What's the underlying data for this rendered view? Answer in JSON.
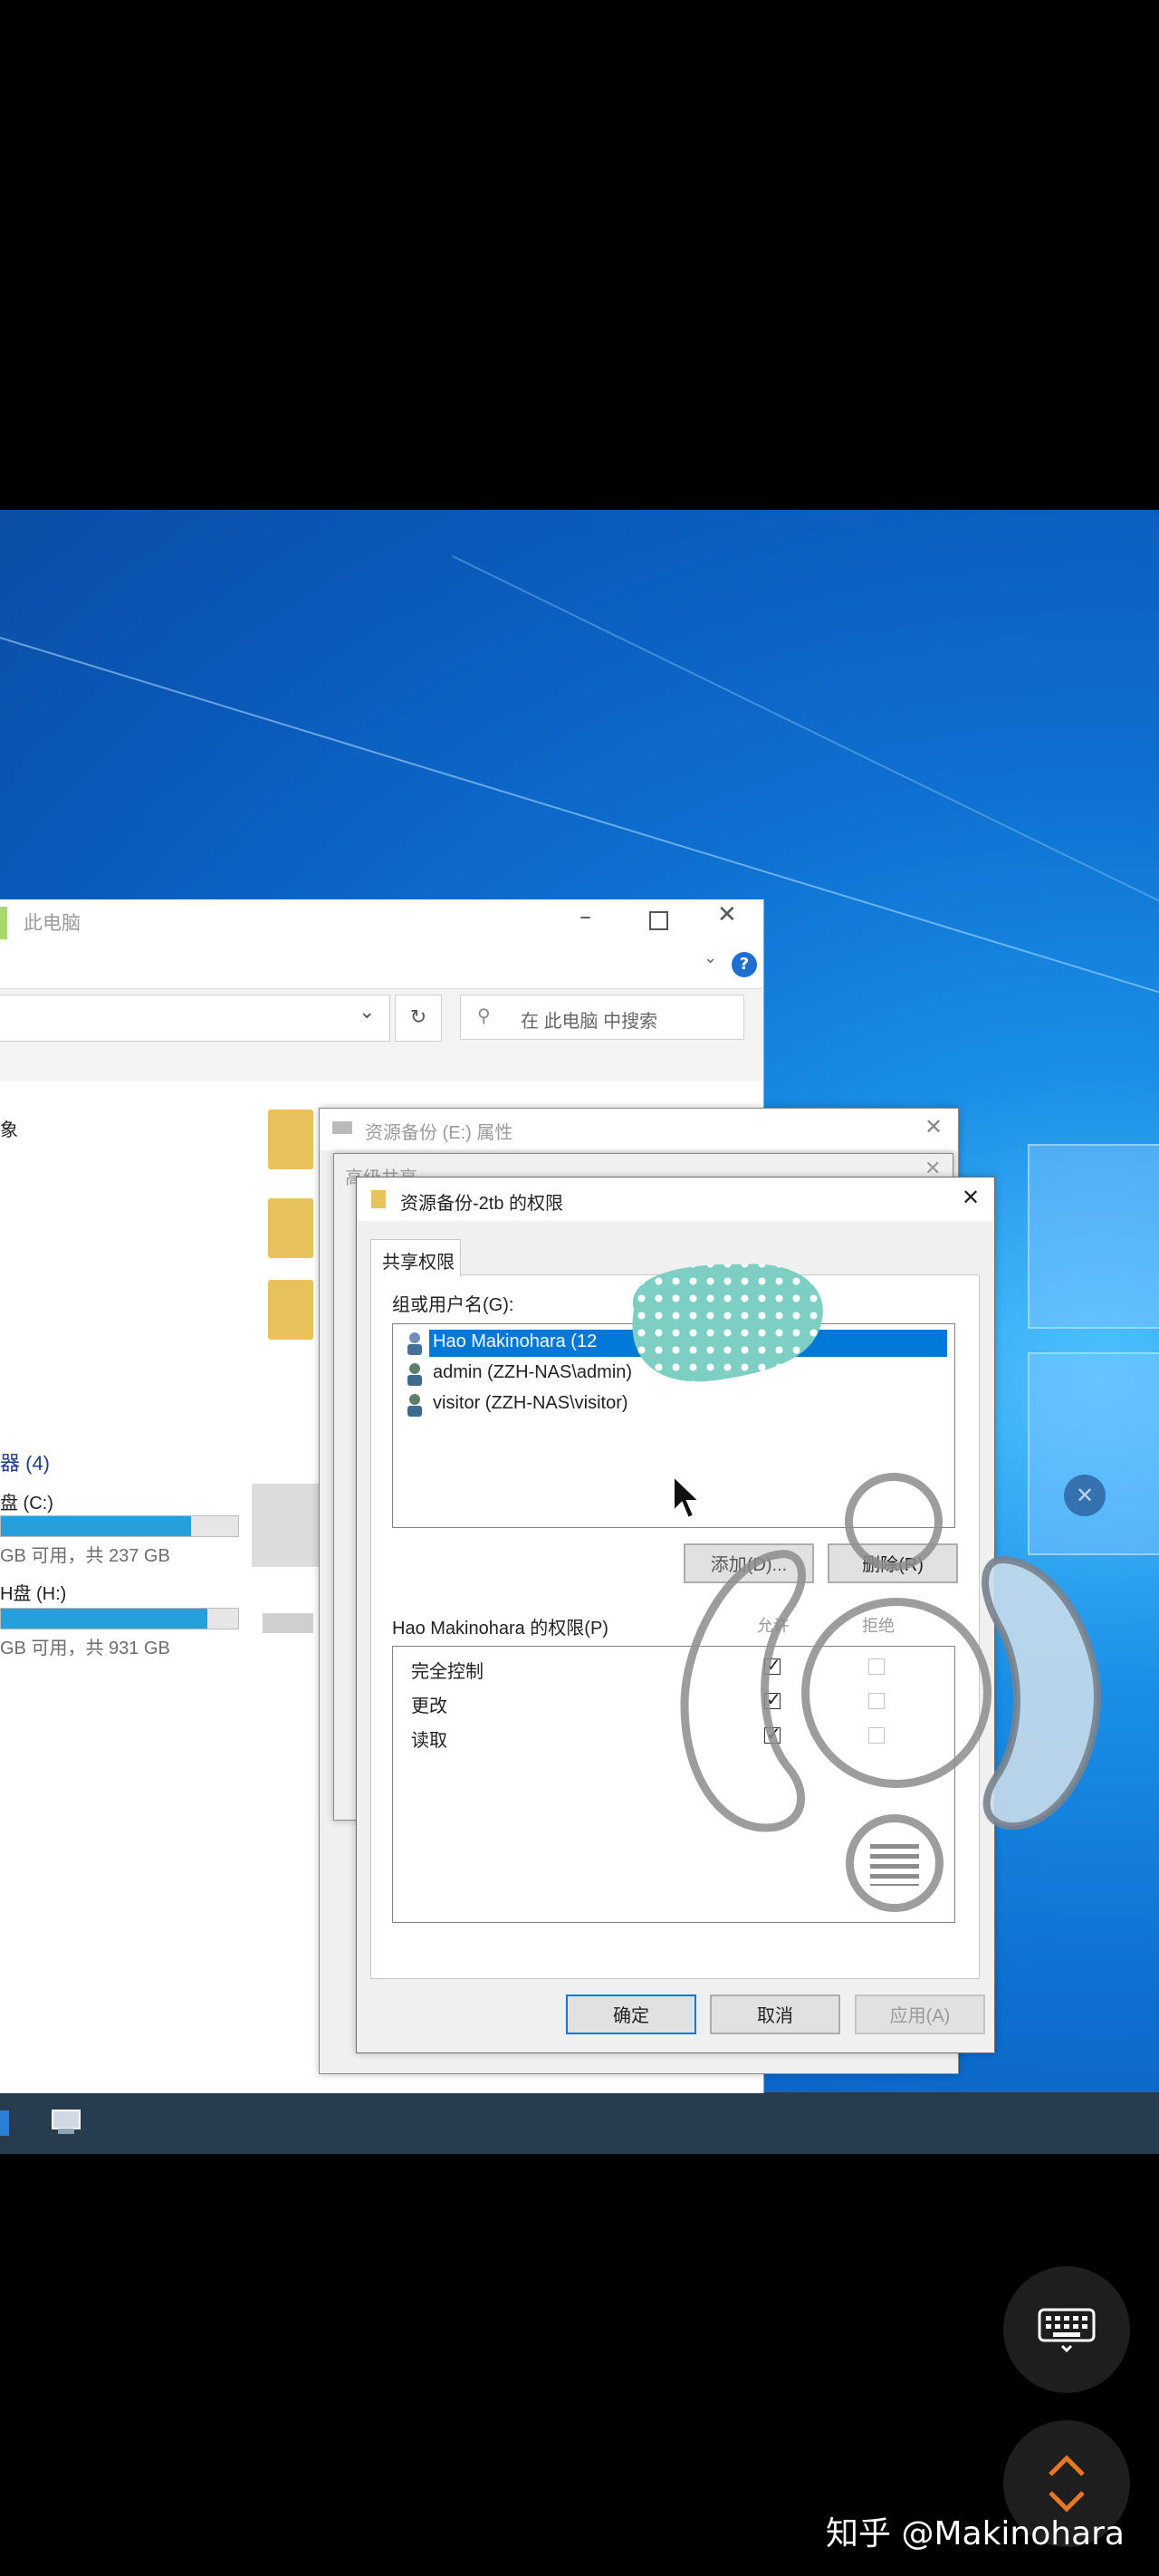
{
  "explorer": {
    "title": "此电脑",
    "search_placeholder": "在 此电脑 中搜索",
    "section_objects": "象",
    "section_devices": "器 (4)",
    "drives": [
      {
        "name": "盘 (C:)",
        "info": "GB 可用，共 237 GB",
        "fill": 0.8
      },
      {
        "name": "H盘 (H:)",
        "info": "GB 可用，共 931 GB",
        "fill": 0.87
      }
    ]
  },
  "properties_dialog": {
    "title": "资源备份 (E:) 属性"
  },
  "advanced_sharing_dialog": {
    "title": "高级共享"
  },
  "permissions_dialog": {
    "title": "资源备份-2tb 的权限",
    "tab": "共享权限",
    "group_label": "组或用户名(G):",
    "users": [
      {
        "label": "Hao Makinohara (12",
        "selected": true
      },
      {
        "label": "admin (ZZH-NAS\\admin)",
        "selected": false
      },
      {
        "label": "visitor (ZZH-NAS\\visitor)",
        "selected": false
      }
    ],
    "add_button": "添加(D)...",
    "remove_button": "删除(R)",
    "perm_label": "Hao Makinohara 的权限(P)",
    "col_allow": "允许",
    "col_deny": "拒绝",
    "permissions": [
      {
        "name": "完全控制",
        "allow": true,
        "deny": false
      },
      {
        "name": "更改",
        "allow": true,
        "deny": false
      },
      {
        "name": "读取",
        "allow": true,
        "deny": false
      }
    ],
    "ok_button": "确定",
    "cancel_button": "取消",
    "apply_button": "应用(A)"
  },
  "watermark": "知乎 @Makinohara",
  "colors": {
    "accent": "#0078d7",
    "desktop": "#0e6fd0",
    "taskbar": "#273c4f"
  }
}
